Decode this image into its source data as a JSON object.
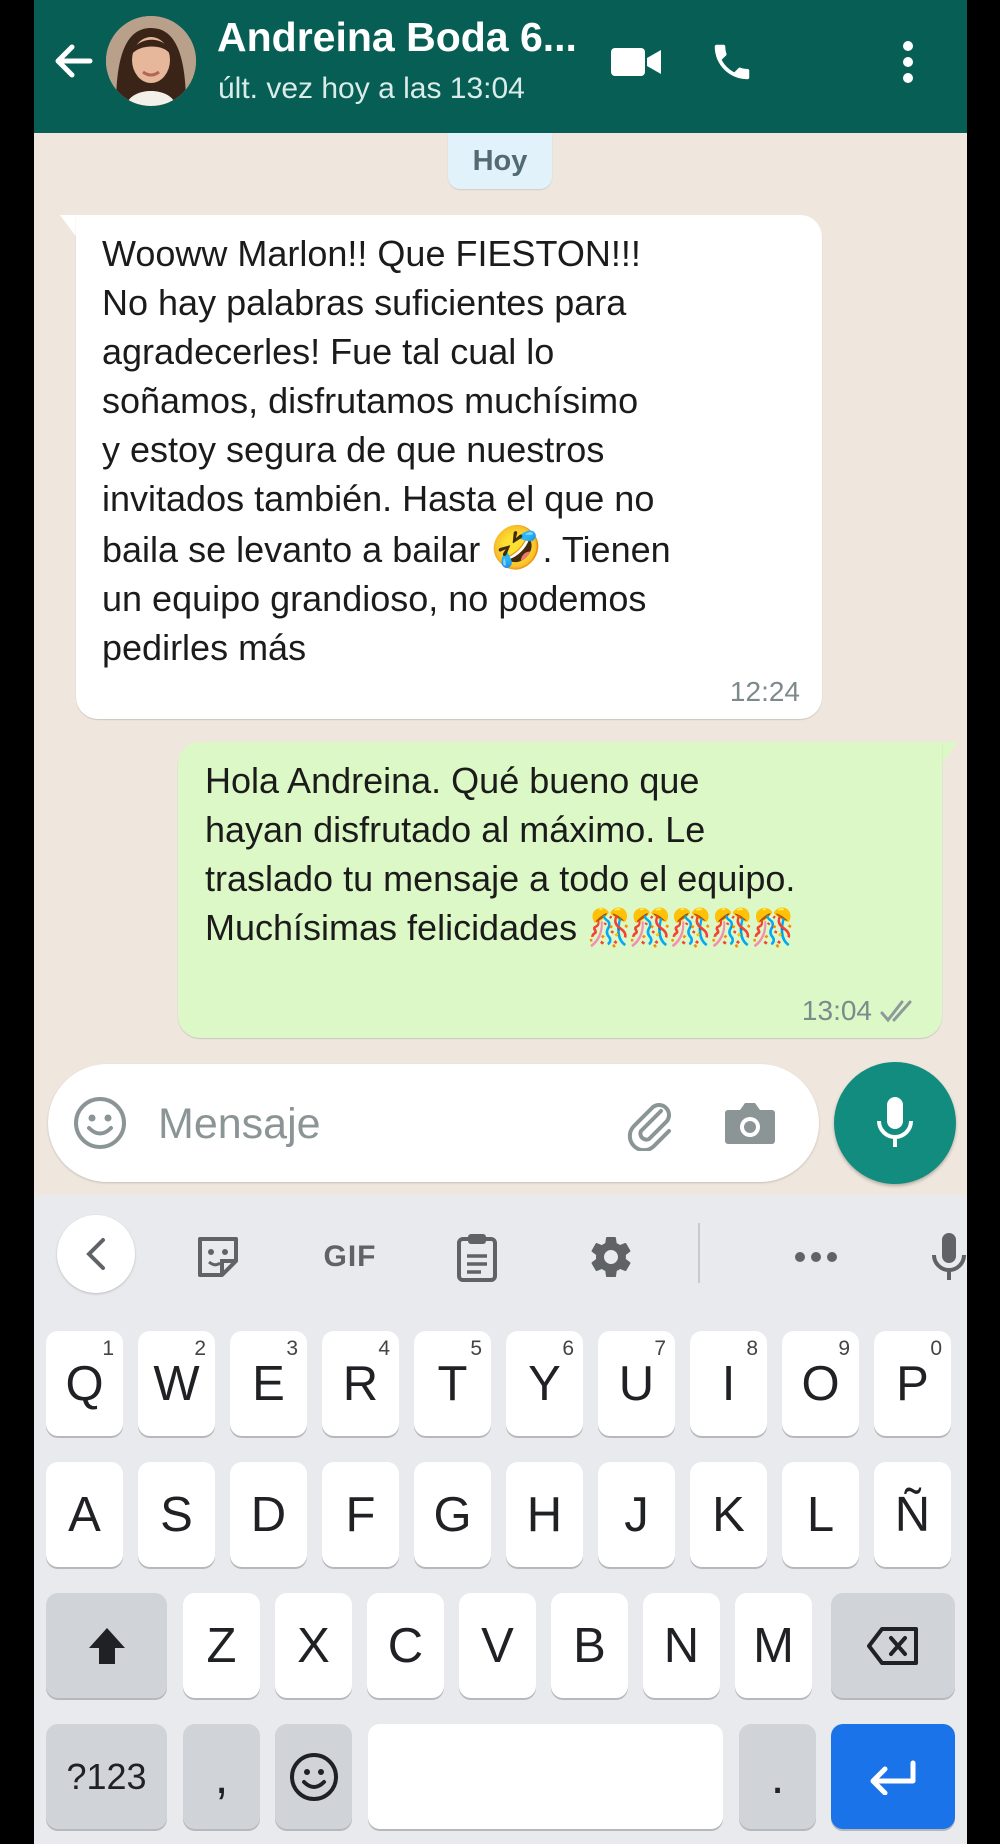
{
  "header": {
    "contact_name": "Andreina Boda 6...",
    "status": "últ. vez hoy a las 13:04",
    "icons": [
      "back-arrow-icon",
      "video-call-icon",
      "phone-call-icon",
      "more-options-icon"
    ]
  },
  "chat": {
    "date_label": "Hoy",
    "messages": [
      {
        "direction": "incoming",
        "text_before_emoji": "Wooww Marlon!! Que FIESTON!!!\nNo hay palabras suficientes para\nagradecerles! Fue tal cual lo\nsoñamos, disfrutamos muchísimo\ny estoy segura de que nuestros\ninvitados también. Hasta el que no\nbaila se levanto a bailar ",
        "emoji": "🤣",
        "text_after_emoji": ". Tienen\nun equipo grandioso, no podemos\npedirles más",
        "time": "12:24"
      },
      {
        "direction": "outgoing",
        "text": "Hola Andreina. Qué bueno que\nhayan disfrutado al máximo. Le\ntraslado tu mensaje a todo el equipo.\nMuchísimas felicidades ",
        "emoji": "🎊🎊🎊🎊🎊",
        "time": "13:04",
        "read_status": "read"
      }
    ]
  },
  "composer": {
    "placeholder": "Mensaje",
    "icons": [
      "emoji-icon",
      "attach-icon",
      "camera-icon",
      "microphone-icon"
    ]
  },
  "keyboard": {
    "toolbar": {
      "gif_label": "GIF",
      "icons": [
        "collapse-icon",
        "sticker-icon",
        "gif-icon",
        "clipboard-icon",
        "settings-icon",
        "more-icon",
        "voice-input-icon"
      ]
    },
    "row1": [
      {
        "label": "Q",
        "hint": "1"
      },
      {
        "label": "W",
        "hint": "2"
      },
      {
        "label": "E",
        "hint": "3"
      },
      {
        "label": "R",
        "hint": "4"
      },
      {
        "label": "T",
        "hint": "5"
      },
      {
        "label": "Y",
        "hint": "6"
      },
      {
        "label": "U",
        "hint": "7"
      },
      {
        "label": "I",
        "hint": "8"
      },
      {
        "label": "O",
        "hint": "9"
      },
      {
        "label": "P",
        "hint": "0"
      }
    ],
    "row2": [
      "A",
      "S",
      "D",
      "F",
      "G",
      "H",
      "J",
      "K",
      "L",
      "Ñ"
    ],
    "row3": [
      "Z",
      "X",
      "C",
      "V",
      "B",
      "N",
      "M"
    ],
    "row4": {
      "symbols": "?123",
      "comma": ",",
      "period": "."
    }
  },
  "colors": {
    "header": "#075e54",
    "chat_background": "#efe7dd",
    "outgoing_bubble": "#dcf8c6",
    "incoming_bubble": "#ffffff",
    "mic_button": "#128c7e",
    "read_ticks": "#7d8a8c",
    "enter_key": "#1a73e8"
  }
}
